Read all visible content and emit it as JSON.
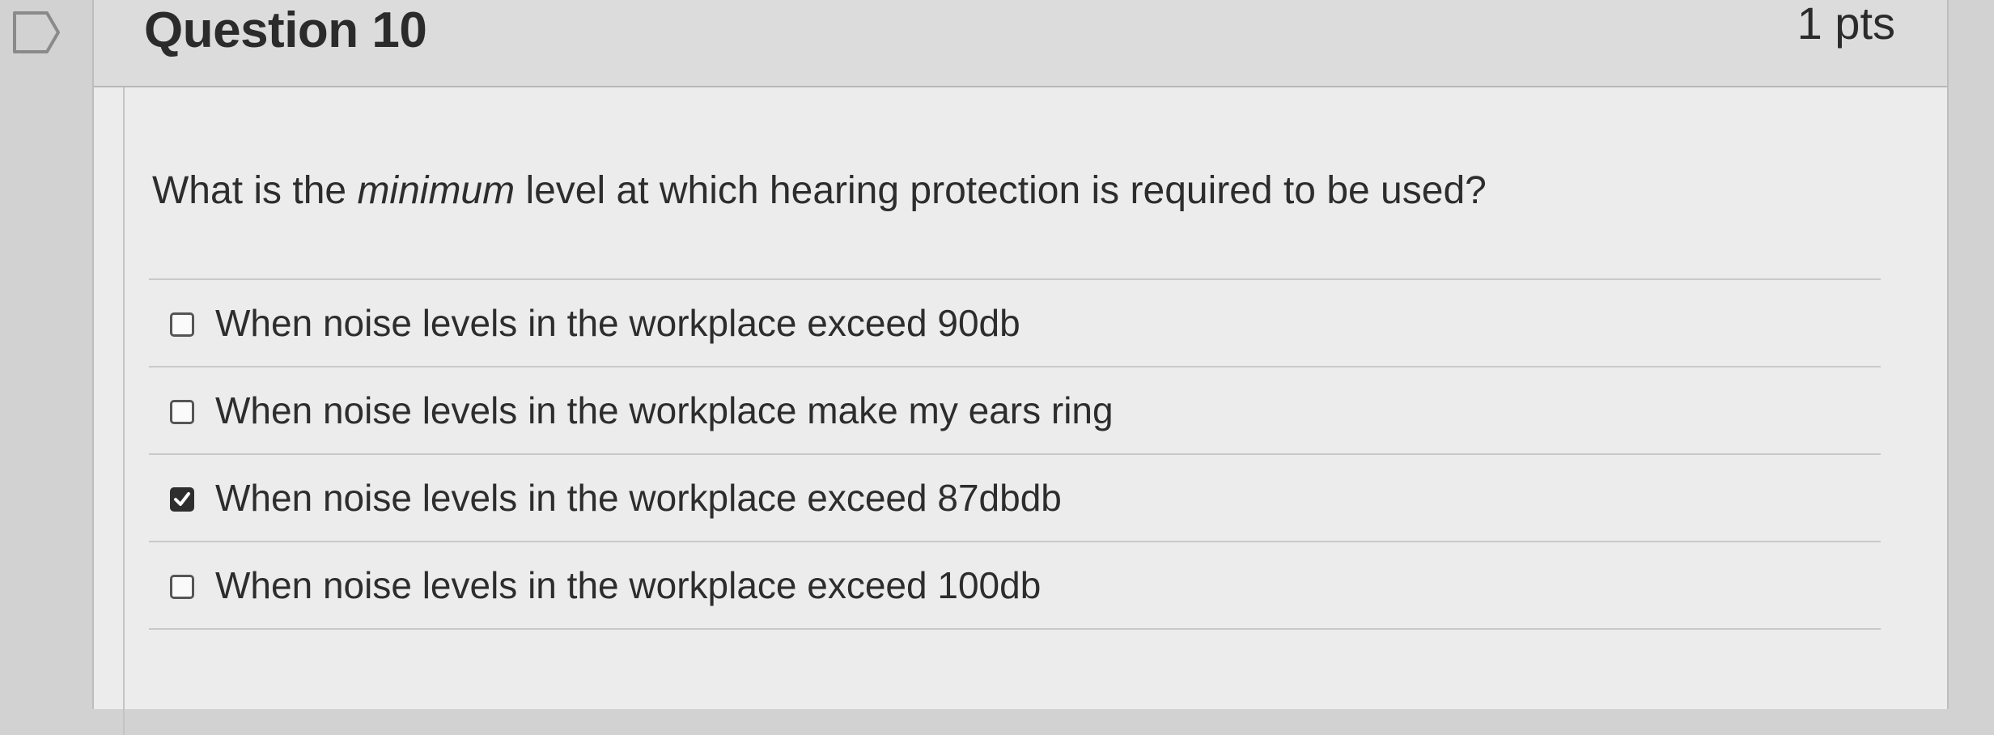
{
  "question": {
    "title": "Question 10",
    "points": "1 pts",
    "text_before": "What is the ",
    "text_emphasis": "minimum",
    "text_after": " level at which hearing protection is required to be used?"
  },
  "answers": [
    {
      "label": "When noise levels in the workplace exceed 90db",
      "checked": false
    },
    {
      "label": "When noise levels in the workplace make my ears ring",
      "checked": false
    },
    {
      "label": "When noise levels in the workplace exceed 87dbdb",
      "checked": true
    },
    {
      "label": "When noise levels in the workplace exceed 100db",
      "checked": false
    }
  ],
  "icons": {
    "flag": "flag-question-icon",
    "check": "checkmark-icon"
  },
  "colors": {
    "page_background": "#d2d2d2",
    "card_background": "#ececec",
    "header_background": "#dcdcdc",
    "text": "#2d2d2d",
    "checked_box": "#2e2e2e"
  }
}
